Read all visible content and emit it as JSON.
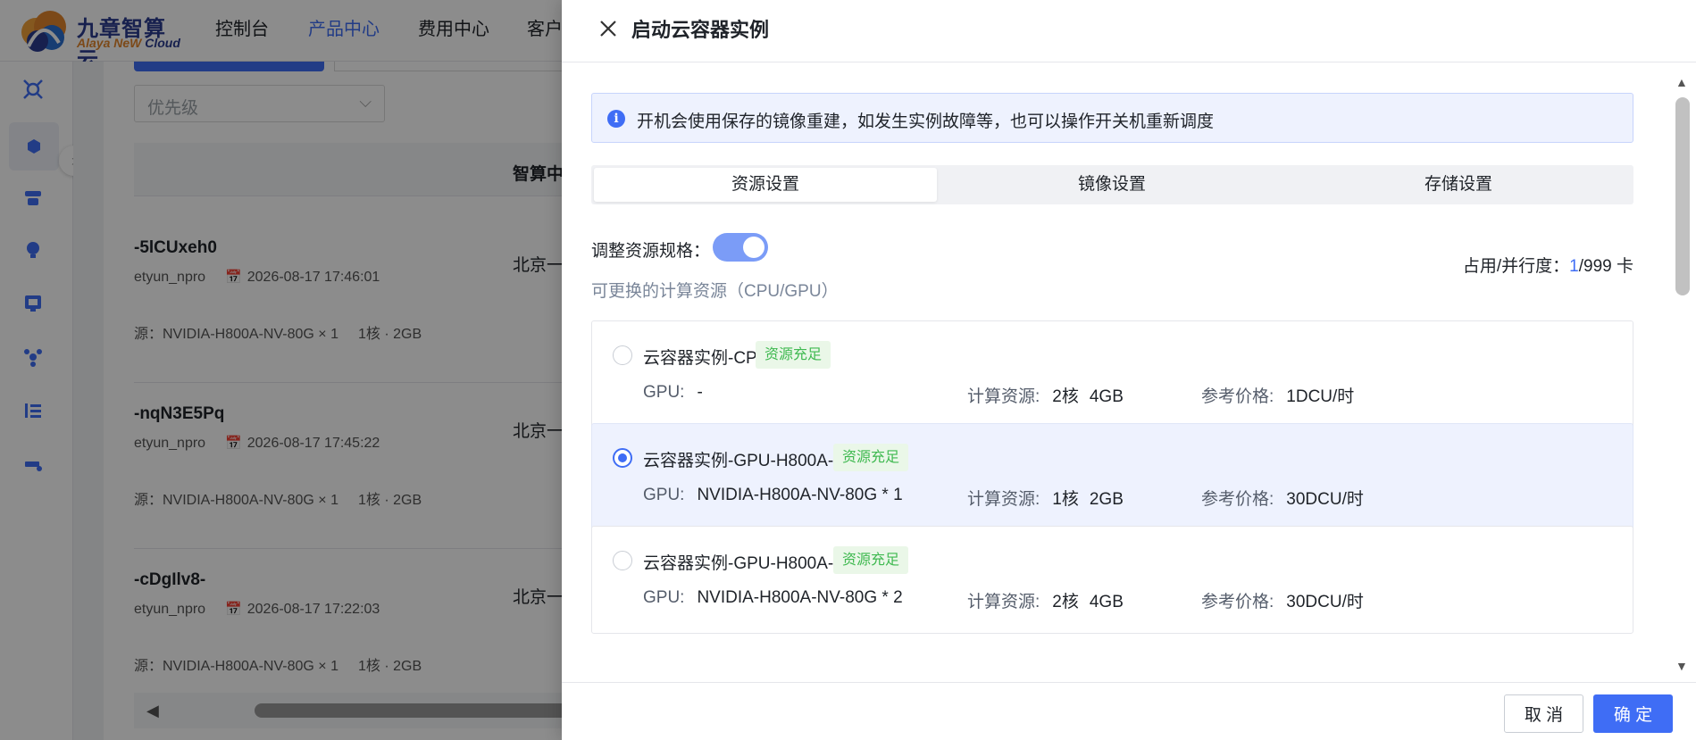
{
  "brand": {
    "name_cn": "九章智算云",
    "name_en_1": "Alaya NeW",
    "name_en_2": "Cloud"
  },
  "topnav": [
    "控制台",
    "产品中心",
    "费用中心",
    "客户"
  ],
  "background": {
    "filter_placeholder": "优先级",
    "table_column": "智算中",
    "instances": [
      {
        "name": "-5lCUxeh0",
        "user": "etyun_npro",
        "time": "2026-08-17 17:46:01",
        "resource": "源：NVIDIA-H800A-NV-80G × 1",
        "spec": "1核 · 2GB",
        "region": "北京一"
      },
      {
        "name": "-nqN3E5Pq",
        "user": "etyun_npro",
        "time": "2026-08-17 17:45:22",
        "resource": "源：NVIDIA-H800A-NV-80G × 1",
        "spec": "1核 · 2GB",
        "region": "北京一"
      },
      {
        "name": "-cDgIlv8-",
        "user": "etyun_npro",
        "time": "2026-08-17 17:22:03",
        "resource": "源：NVIDIA-H800A-NV-80G × 1",
        "spec": "1核 · 2GB",
        "region": "北京一"
      }
    ]
  },
  "drawer": {
    "title": "启动云容器实例",
    "info": "开机会使用保存的镜像重建，如发生实例故障等，也可以操作开关机重新调度",
    "tabs": [
      "资源设置",
      "镜像设置",
      "存储设置"
    ],
    "adjust_label": "调整资源规格：",
    "toggle_on": true,
    "usage_label": "占用/并行度：",
    "usage_used": "1",
    "usage_total": "/999 卡",
    "sub_label": "可更换的计算资源（CPU/GPU）",
    "gpu_key": "GPU:",
    "compute_key": "计算资源:",
    "price_key": "参考价格:",
    "options": [
      {
        "name": "云容器实例-CPU",
        "badge": "资源充足",
        "gpu": "-",
        "cores": "2核",
        "mem": "4GB",
        "price": "1DCU/时",
        "selected": false
      },
      {
        "name": "云容器实例-GPU-H800A-1卡",
        "badge": "资源充足",
        "gpu": "NVIDIA-H800A-NV-80G * 1",
        "cores": "1核",
        "mem": "2GB",
        "price": "30DCU/时",
        "selected": true
      },
      {
        "name": "云容器实例-GPU-H800A-2卡",
        "badge": "资源充足",
        "gpu": "NVIDIA-H800A-NV-80G * 2",
        "cores": "2核",
        "mem": "4GB",
        "price": "30DCU/时",
        "selected": false
      }
    ],
    "cancel_label": "取 消",
    "ok_label": "确 定"
  },
  "colors": {
    "accent": "#3f6df5",
    "success": "#3fb950",
    "brand_orange": "#e2862c",
    "brand_navy": "#2a3b8f"
  }
}
